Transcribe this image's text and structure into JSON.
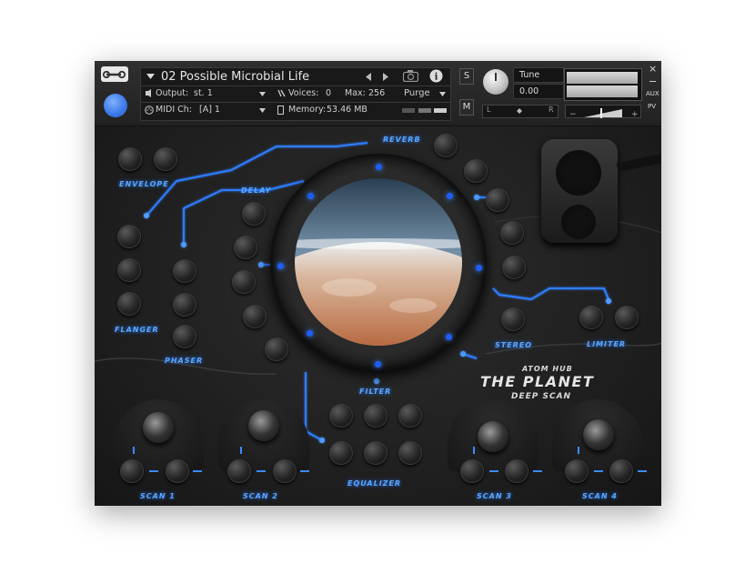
{
  "header": {
    "instrument_name": "02 Possible Microbial Life",
    "output_label": "Output:",
    "output_value": "st. 1",
    "voices_label": "Voices:",
    "voices_value": "0",
    "max_label": "Max:",
    "max_value": "256",
    "purge_label": "Purge",
    "midi_label": "MIDI Ch:",
    "midi_value": "[A] 1",
    "memory_label": "Memory:",
    "memory_value": "53.46 MB",
    "solo_label": "S",
    "mute_label": "M",
    "tune_label": "Tune",
    "tune_value": "0.00",
    "pan_left": "L",
    "pan_right": "R",
    "aux_label": "AUX",
    "pv_label": "PV",
    "close_glyph": "×",
    "minimize_glyph": "−"
  },
  "labels": {
    "envelope": "ENVELOPE",
    "delay": "DELAY",
    "reverb": "REVERB",
    "flanger": "FLANGER",
    "phaser": "PHASER",
    "stereo": "STEREO",
    "limiter": "LIMITER",
    "filter": "FILTER",
    "equalizer": "EQUALIZER",
    "scan1": "SCAN 1",
    "scan2": "SCAN 2",
    "scan3": "SCAN 3",
    "scan4": "SCAN 4"
  },
  "brand": {
    "line1": "ATOM HUB",
    "line2": "THE PLANET",
    "line3": "DEEP SCAN"
  },
  "colors": {
    "accent": "#3a8bff",
    "background": "#1c1c1c"
  }
}
